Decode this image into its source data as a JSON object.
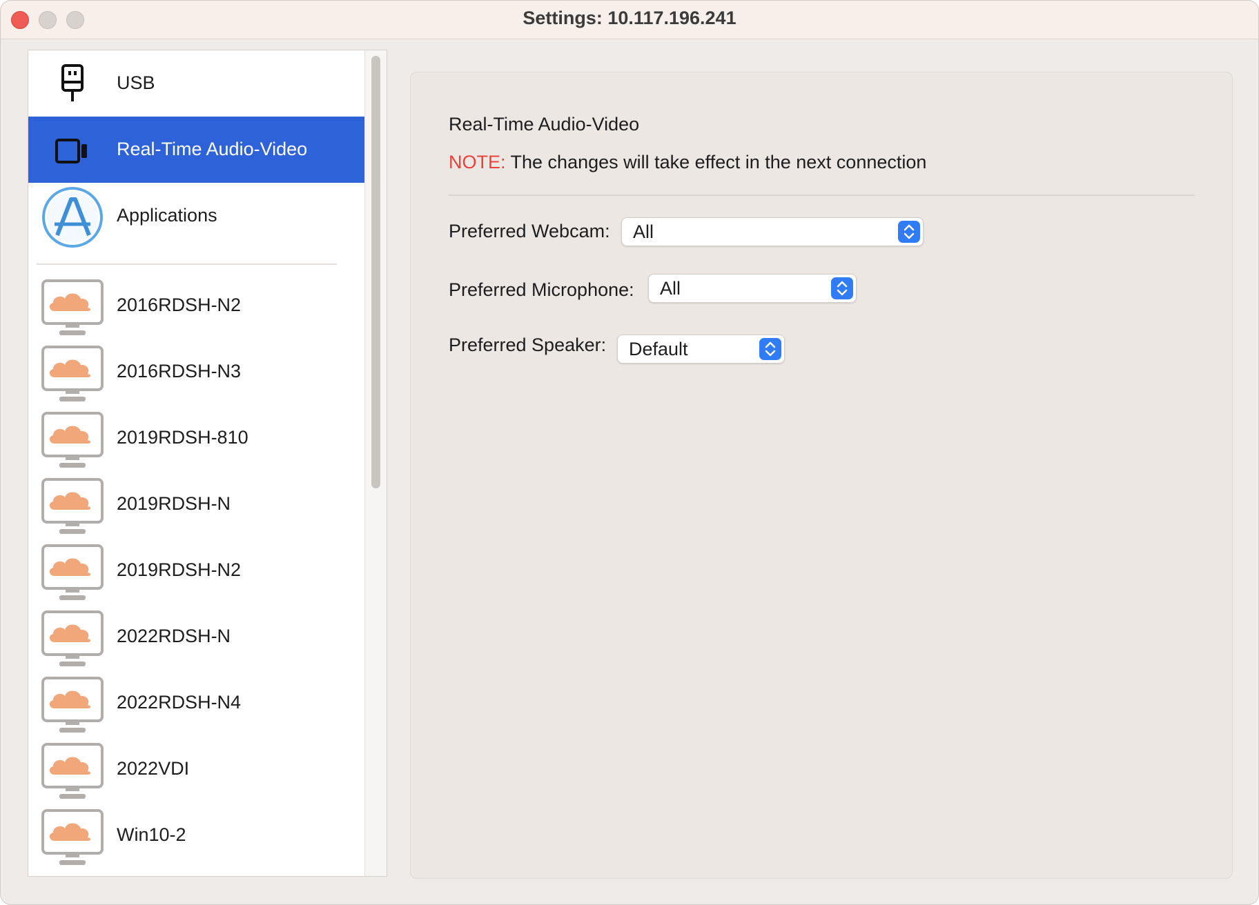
{
  "window": {
    "title": "Settings: 10.117.196.241"
  },
  "sidebar": {
    "items": [
      {
        "label": "USB",
        "icon": "usb-icon"
      },
      {
        "label": "Real-Time Audio-Video",
        "icon": "video-camera-icon",
        "selected": true
      },
      {
        "label": "Applications",
        "icon": "app-store-icon"
      },
      {
        "label": "2016RDSH-N2",
        "icon": "cloud-desktop-icon"
      },
      {
        "label": "2016RDSH-N3",
        "icon": "cloud-desktop-icon"
      },
      {
        "label": "2019RDSH-810",
        "icon": "cloud-desktop-icon"
      },
      {
        "label": "2019RDSH-N",
        "icon": "cloud-desktop-icon"
      },
      {
        "label": "2019RDSH-N2",
        "icon": "cloud-desktop-icon"
      },
      {
        "label": "2022RDSH-N",
        "icon": "cloud-desktop-icon"
      },
      {
        "label": "2022RDSH-N4",
        "icon": "cloud-desktop-icon"
      },
      {
        "label": "2022VDI",
        "icon": "cloud-desktop-icon"
      },
      {
        "label": "Win10-2",
        "icon": "cloud-desktop-icon"
      }
    ]
  },
  "panel": {
    "title": "Real-Time Audio-Video",
    "note_key": "NOTE:",
    "note_text": " The changes will take effect in the next connection",
    "webcam": {
      "label": "Preferred Webcam:",
      "value": "All"
    },
    "microphone": {
      "label": "Preferred Microphone:",
      "value": "All"
    },
    "speaker": {
      "label": "Preferred Speaker:",
      "value": "Default"
    }
  },
  "colors": {
    "selection": "#2d62d9",
    "note": "#e8433b",
    "stepper": "#2f7cf6",
    "cloud": "#f2a77b"
  }
}
